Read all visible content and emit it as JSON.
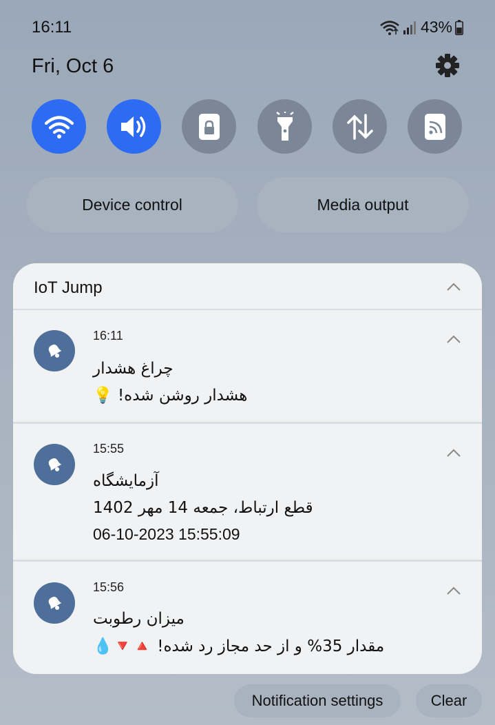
{
  "status_bar": {
    "time": "16:11",
    "battery": "43%",
    "icons": [
      "wifi-icon",
      "signal-icon",
      "battery-icon"
    ]
  },
  "header": {
    "date": "Fri, Oct 6",
    "settings_icon": "gear-icon"
  },
  "quick_toggles": [
    {
      "name": "wifi",
      "icon": "wifi-icon",
      "active": true
    },
    {
      "name": "sound",
      "icon": "speaker-icon",
      "active": true
    },
    {
      "name": "screen-lock",
      "icon": "lock-icon",
      "active": false
    },
    {
      "name": "flashlight",
      "icon": "flashlight-icon",
      "active": false
    },
    {
      "name": "mobile-data",
      "icon": "data-arrows-icon",
      "active": false
    },
    {
      "name": "cast",
      "icon": "cast-icon",
      "active": false
    }
  ],
  "pills": {
    "device_control": "Device control",
    "media_output": "Media output"
  },
  "notification_group": {
    "app_name": "IoT Jump",
    "notifications": [
      {
        "time": "16:11",
        "title": "چراغ هشدار",
        "lines": [
          "هشدار روشن شده! 💡"
        ]
      },
      {
        "time": "15:55",
        "title": "آزمایشگاه",
        "lines": [
          "قطع ارتباط، جمعه 14 مهر 1402",
          "06-10-2023 15:55:09"
        ]
      },
      {
        "time": "15:56",
        "title": "میزان رطوبت",
        "lines": [
          "مقدار 35% و از حد مجاز رد شده! 🔺🔻💧"
        ]
      }
    ]
  },
  "footer": {
    "notification_settings": "Notification settings",
    "clear": "Clear"
  },
  "colors": {
    "accent": "#2d6bf3",
    "avatar": "#4e6f99",
    "toggle_off": "#7b8796"
  }
}
